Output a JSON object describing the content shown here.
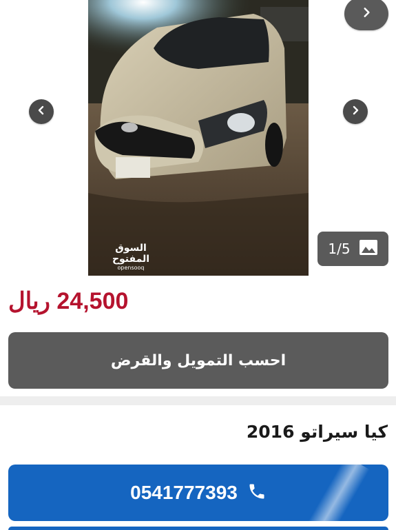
{
  "gallery": {
    "counter": "1/5",
    "watermark": {
      "arabic": "السوق المفتوح",
      "latin": "opensooq"
    },
    "icons": {
      "prev": "chevron-left-icon",
      "next": "chevron-right-icon",
      "top_next": "chevron-right-icon",
      "gallery": "image-icon"
    }
  },
  "listing": {
    "price": "24,500 ريال",
    "finance_button": "احسب التمويل والقرض",
    "title": "كيا سيراتو 2016",
    "phone": "0541777393"
  },
  "colors": {
    "price": "#b5132e",
    "call_button": "#1565c0",
    "finance_button": "#5b5b5b",
    "nav_button": "#4a4a4a"
  }
}
